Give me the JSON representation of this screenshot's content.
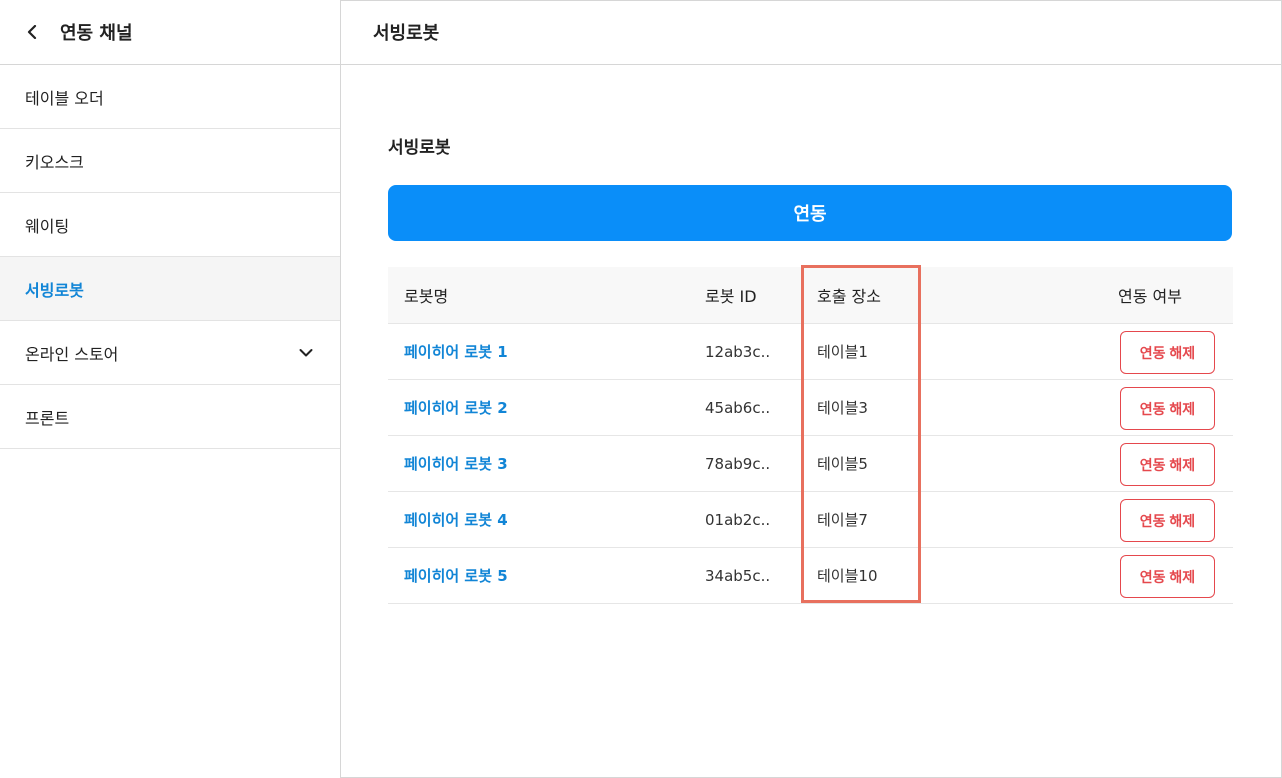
{
  "sidebar": {
    "title": "연동 채널",
    "items": [
      {
        "label": "테이블 오더"
      },
      {
        "label": "키오스크"
      },
      {
        "label": "웨이팅"
      },
      {
        "label": "서빙로봇"
      },
      {
        "label": "온라인 스토어"
      },
      {
        "label": "프론트"
      }
    ],
    "active_index": 3
  },
  "header": {
    "title": "서빙로봇"
  },
  "main": {
    "section_title": "서빙로봇",
    "link_button_label": "연동",
    "table": {
      "columns": [
        "로봇명",
        "로봇 ID",
        "호출 장소",
        "연동 여부"
      ],
      "rows": [
        {
          "name": "페이히어 로봇 1",
          "id": "12ab3c..",
          "location": "테이블1",
          "action": "연동 해제"
        },
        {
          "name": "페이히어 로봇 2",
          "id": "45ab6c..",
          "location": "테이블3",
          "action": "연동 해제"
        },
        {
          "name": "페이히어 로봇 3",
          "id": "78ab9c..",
          "location": "테이블5",
          "action": "연동 해제"
        },
        {
          "name": "페이히어 로봇 4",
          "id": "01ab2c..",
          "location": "테이블7",
          "action": "연동 해제"
        },
        {
          "name": "페이히어 로봇 5",
          "id": "34ab5c..",
          "location": "테이블10",
          "action": "연동 해제"
        }
      ]
    }
  },
  "colors": {
    "accent": "#0a8ef9",
    "link_text": "#1185d6",
    "danger": "#e5484d",
    "highlight": "#e8705e"
  },
  "icons": {
    "back": "chevron-left-icon",
    "expand": "chevron-down-icon"
  }
}
